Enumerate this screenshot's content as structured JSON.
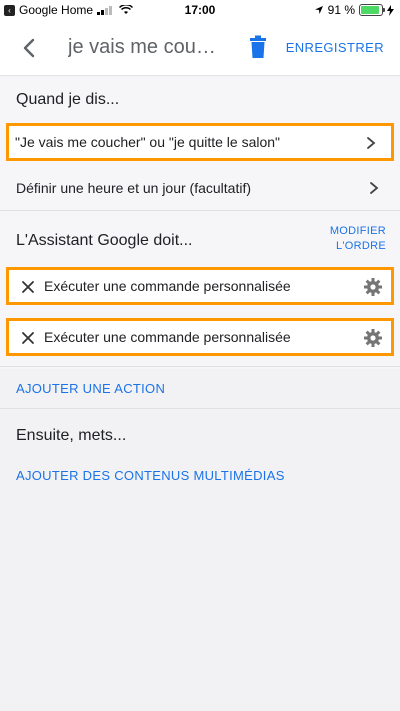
{
  "status_bar": {
    "back_app": "Google Home",
    "time": "17:00",
    "battery": "91 %",
    "battery_level": 0.91
  },
  "app_bar": {
    "title": "je vais me couch…",
    "save_label": "ENREGISTRER"
  },
  "when_section": {
    "title": "Quand je dis...",
    "phrases": "\"Je vais me coucher\" ou \"je quitte le salon\"",
    "time_day": "Définir une heure et un jour (facultatif)"
  },
  "assistant_section": {
    "title": "L'Assistant Google doit...",
    "reorder_line1": "MODIFIER",
    "reorder_line2": "L'ORDRE",
    "actions": [
      {
        "label": "Exécuter une commande personnalisée"
      },
      {
        "label": "Exécuter une commande personnalisée"
      }
    ],
    "add_action": "AJOUTER UNE ACTION"
  },
  "media_section": {
    "title": "Ensuite, mets...",
    "add_media": "AJOUTER DES CONTENUS MULTIMÉDIAS"
  },
  "colors": {
    "accent": "#1a73e8",
    "highlight": "#ff9800"
  }
}
